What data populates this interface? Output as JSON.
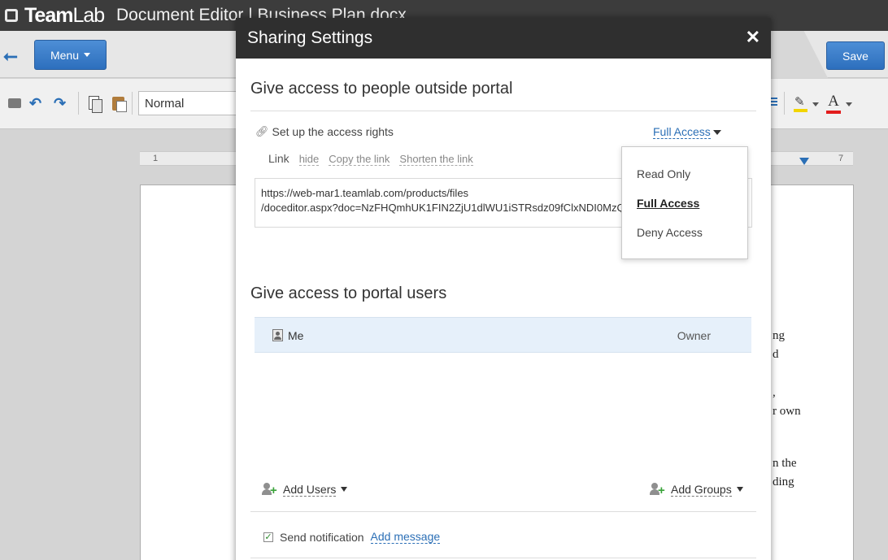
{
  "app": {
    "logo_prefix": "Team",
    "logo_suffix": "Lab",
    "title": "Document Editor | Business Plan.docx"
  },
  "toolbar": {
    "menu_label": "Menu",
    "save_label": "Save",
    "style_value": "Normal",
    "undo_icon": "undo-icon",
    "redo_icon": "redo-icon"
  },
  "ruler": {
    "start_label": "1",
    "end_label": "7"
  },
  "document": {
    "fragments": [
      "ng",
      "d",
      ",",
      "r own",
      "n the",
      "ding"
    ]
  },
  "dialog": {
    "title": "Sharing Settings",
    "close_label": "✕",
    "outside_section": {
      "title": "Give access to people outside portal",
      "setup_label": "Set up the access rights",
      "access_value": "Full Access",
      "link_label": "Link",
      "hide_label": "hide",
      "copy_label": "Copy the link",
      "shorten_label": "Shorten the link",
      "url_line1": "https://web-mar1.teamlab.com/products/files",
      "url_line2": "/doceditor.aspx?doc=NzFHQmhUK1FIN2ZjU1dlWU1iSTRsdz09fClxNDI0MzQ4"
    },
    "access_options": {
      "read_only": "Read Only",
      "full_access": "Full Access",
      "deny_access": "Deny Access",
      "selected": "Full Access"
    },
    "portal_section": {
      "title": "Give access to portal users",
      "users": [
        {
          "name": "Me",
          "role": "Owner"
        }
      ],
      "add_users_label": "Add Users",
      "add_groups_label": "Add Groups"
    },
    "notification": {
      "label": "Send notification",
      "checked": true,
      "add_message_label": "Add message"
    }
  },
  "colors": {
    "accent": "#2b6fb6",
    "header": "#2f2f2f",
    "selected_row": "#e6f0fa"
  }
}
